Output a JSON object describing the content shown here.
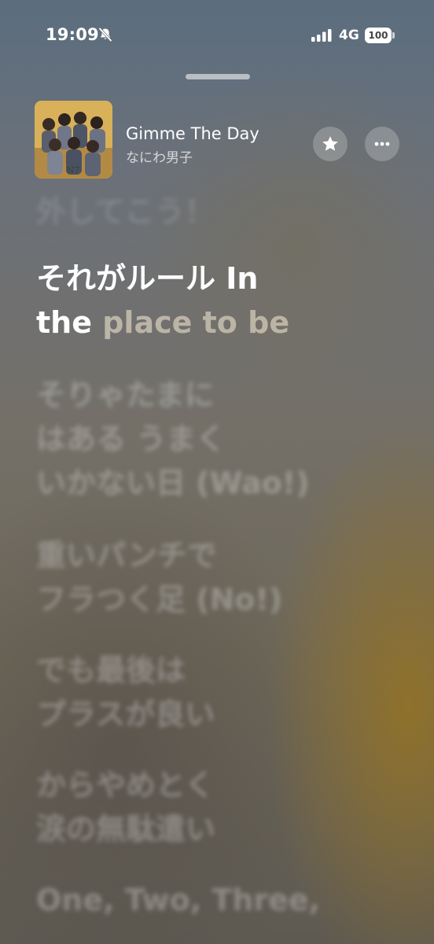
{
  "status": {
    "time": "19:09",
    "network": "4G",
    "battery": "100"
  },
  "player": {
    "title": "Gimme The Day",
    "artist": "なにわ男子",
    "favorite_icon": "star-icon",
    "more_icon": "ellipsis-icon"
  },
  "lyrics": {
    "previous": "外してこう！",
    "current_sung": "それがルール In\nthe ",
    "current_upcoming": "place to be",
    "upcoming": [
      "そりゃたまに\nはある うまく\nいかない日 (Wao!)",
      "重いパンチで\nフラつく足 (No!)",
      "でも最後は\nプラスが良い",
      "からやめとく\n涙の無駄遣い",
      "One, Two, Three,"
    ]
  },
  "colors": {
    "accent": "#ffffff",
    "glow": "#96731f"
  }
}
